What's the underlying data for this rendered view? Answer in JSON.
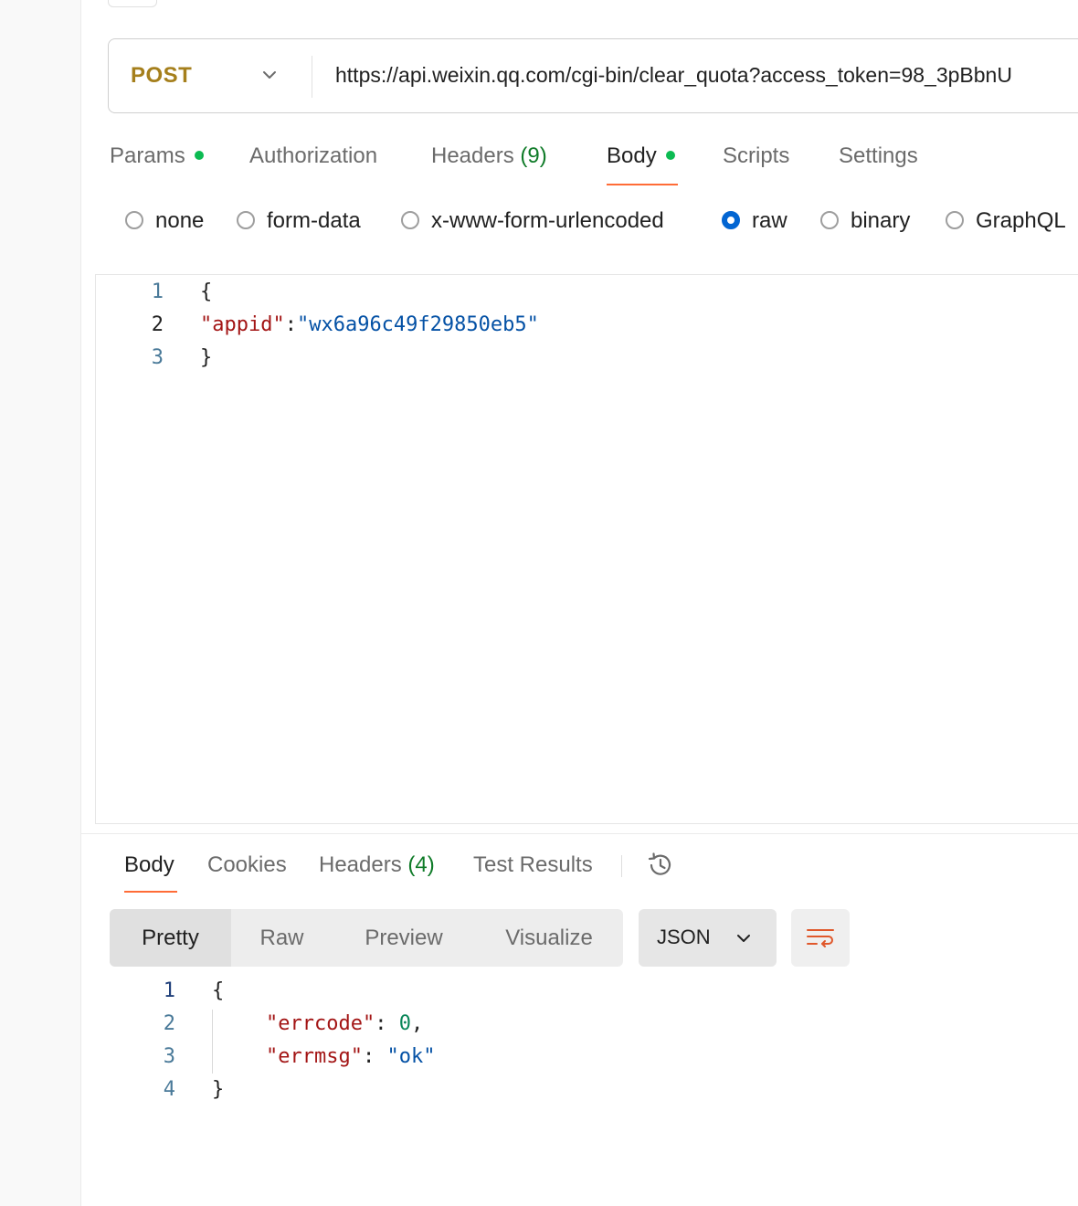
{
  "request": {
    "method": "POST",
    "url": "https://api.weixin.qq.com/cgi-bin/clear_quota?access_token=98_3pBbnU",
    "tabs": {
      "params": "Params",
      "authorization": "Authorization",
      "headers": "Headers",
      "headers_count": "(9)",
      "body": "Body",
      "scripts": "Scripts",
      "settings": "Settings"
    },
    "body_types": [
      "none",
      "form-data",
      "x-www-form-urlencoded",
      "raw",
      "binary",
      "GraphQL"
    ],
    "selected_body_type": "raw",
    "editor": {
      "line_numbers": [
        "1",
        "2",
        "3"
      ],
      "open_brace": "{",
      "key": "\"appid\"",
      "colon": ":",
      "value": "\"wx6a96c49f29850eb5\"",
      "close_brace": "}"
    }
  },
  "response": {
    "tabs": {
      "body": "Body",
      "cookies": "Cookies",
      "headers": "Headers",
      "headers_count": "(4)",
      "test_results": "Test Results"
    },
    "view_modes": [
      "Pretty",
      "Raw",
      "Preview",
      "Visualize"
    ],
    "format": "JSON",
    "editor": {
      "line_numbers": [
        "1",
        "2",
        "3",
        "4"
      ],
      "open_brace": "{",
      "key1": "\"errcode\"",
      "value1": "0",
      "key2": "\"errmsg\"",
      "value2": "\"ok\"",
      "close_brace": "}"
    }
  },
  "colors": {
    "method": "#a57f1c",
    "accent_underline": "#ff6c37",
    "dot_green": "#0cbb52",
    "radio_selected": "#0265d2",
    "json_key": "#a31515",
    "json_string": "#0451a5",
    "json_number": "#098658"
  },
  "icons": [
    "chevron-down-icon",
    "history-icon",
    "wrap-lines-icon"
  ]
}
